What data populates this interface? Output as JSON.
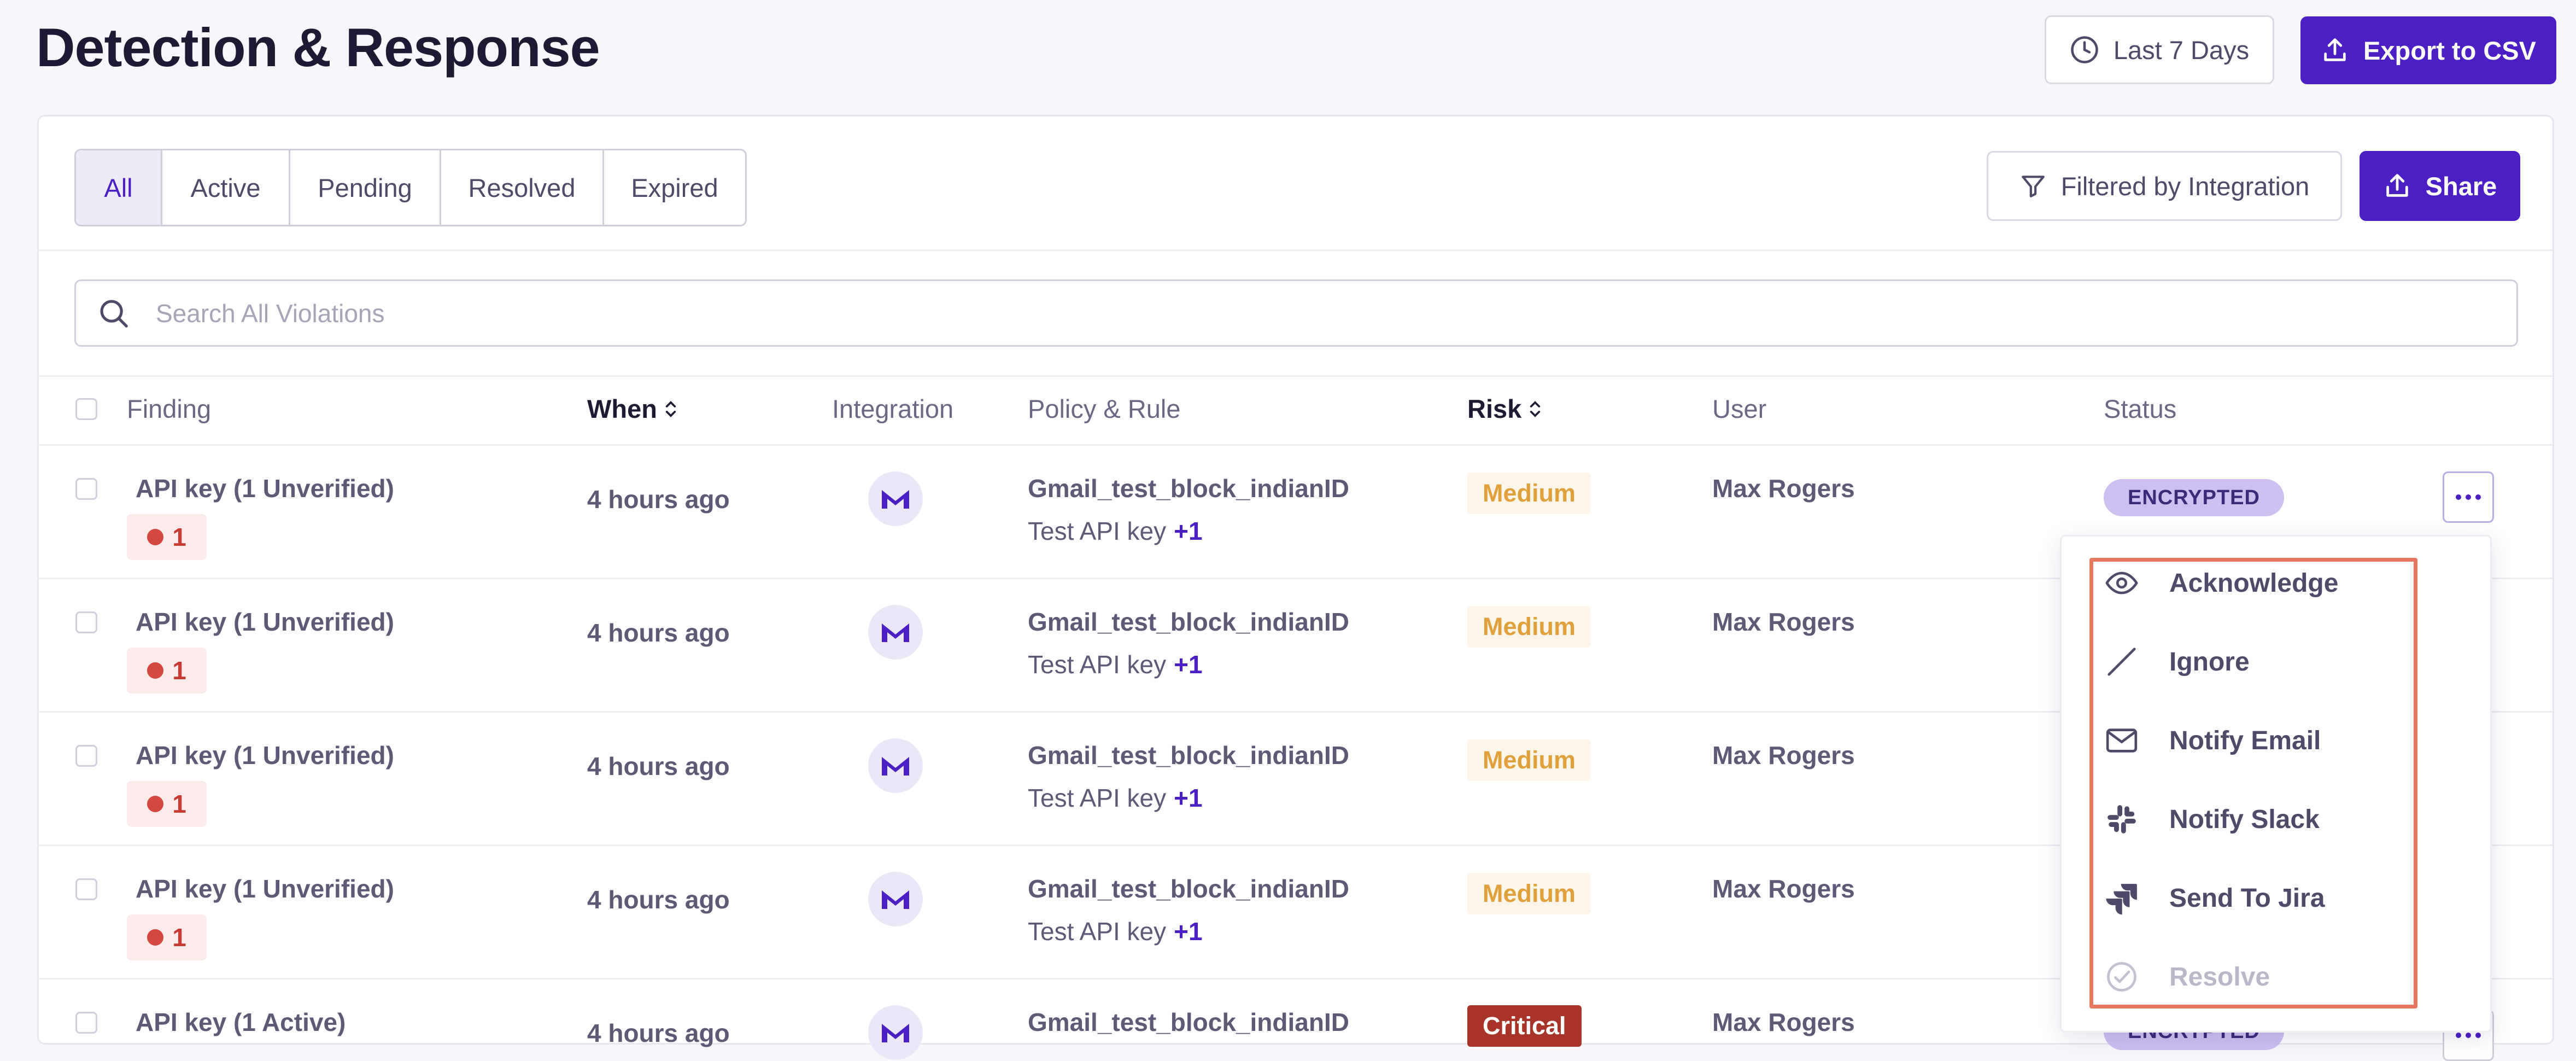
{
  "header": {
    "title": "Detection & Response",
    "date_range_label": "Last 7 Days",
    "export_label": "Export to CSV"
  },
  "tabs": [
    {
      "label": "All",
      "active": true
    },
    {
      "label": "Active",
      "active": false
    },
    {
      "label": "Pending",
      "active": false
    },
    {
      "label": "Resolved",
      "active": false
    },
    {
      "label": "Expired",
      "active": false
    }
  ],
  "toolbar": {
    "filter_label": "Filtered by Integration",
    "share_label": "Share"
  },
  "search": {
    "placeholder": "Search All Violations"
  },
  "table": {
    "columns": [
      "Finding",
      "When",
      "Integration",
      "Policy & Rule",
      "Risk",
      "User",
      "Status"
    ],
    "rows": [
      {
        "finding": "API key (1 Unverified)",
        "count": "1",
        "when": "4 hours ago",
        "integration_icon": "m-logo-icon",
        "policy": "Gmail_test_block_indianID",
        "rule": "Test API key",
        "rule_extra": "+1",
        "risk": "Medium",
        "user": "Max Rogers",
        "status": "ENCRYPTED"
      },
      {
        "finding": "API key (1 Unverified)",
        "count": "1",
        "when": "4 hours ago",
        "integration_icon": "m-logo-icon",
        "policy": "Gmail_test_block_indianID",
        "rule": "Test API key",
        "rule_extra": "+1",
        "risk": "Medium",
        "user": "Max Rogers",
        "status": ""
      },
      {
        "finding": "API key (1 Unverified)",
        "count": "1",
        "when": "4 hours ago",
        "integration_icon": "m-logo-icon",
        "policy": "Gmail_test_block_indianID",
        "rule": "Test API key",
        "rule_extra": "+1",
        "risk": "Medium",
        "user": "Max Rogers",
        "status": ""
      },
      {
        "finding": "API key (1 Unverified)",
        "count": "1",
        "when": "4 hours ago",
        "integration_icon": "m-logo-icon",
        "policy": "Gmail_test_block_indianID",
        "rule": "Test API key",
        "rule_extra": "+1",
        "risk": "Medium",
        "user": "Max Rogers",
        "status": ""
      },
      {
        "finding": "API key (1 Active)",
        "count": "",
        "when": "4 hours ago",
        "integration_icon": "m-logo-icon",
        "policy": "Gmail_test_block_indianID",
        "rule": "",
        "rule_extra": "",
        "risk": "Critical",
        "user": "Max Rogers",
        "status": "ENCRYPTED"
      }
    ]
  },
  "action_menu": {
    "items": [
      {
        "label": "Acknowledge",
        "icon": "eye-icon",
        "disabled": false
      },
      {
        "label": "Ignore",
        "icon": "slash-icon",
        "disabled": false
      },
      {
        "label": "Notify Email",
        "icon": "envelope-icon",
        "disabled": false
      },
      {
        "label": "Notify Slack",
        "icon": "slack-icon",
        "disabled": false
      },
      {
        "label": "Send To Jira",
        "icon": "jira-icon",
        "disabled": false
      },
      {
        "label": "Resolve",
        "icon": "check-circle-icon",
        "disabled": true
      }
    ]
  },
  "colors": {
    "primary": "#4b1fc4",
    "medium_risk": "#e0a03c",
    "critical_risk": "#a83328",
    "finding_badge": "#d54a40",
    "highlight": "#e8775f"
  }
}
